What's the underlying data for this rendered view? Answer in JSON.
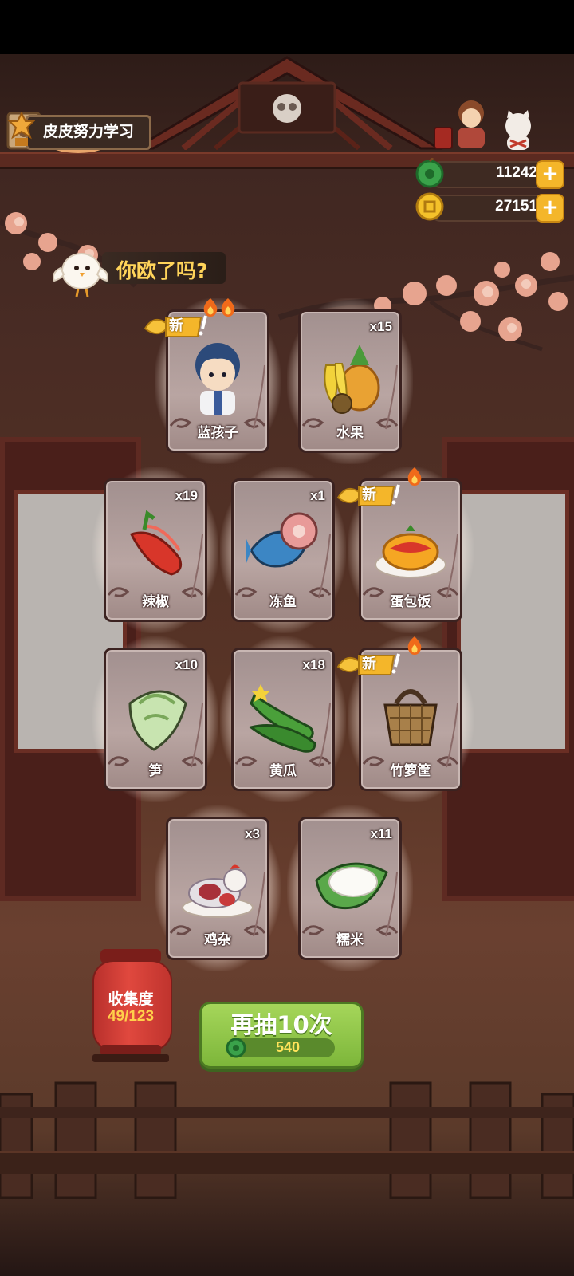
{
  "user": {
    "name": "皮皮努力学习"
  },
  "currencies": [
    {
      "icon": "jade-coin-icon",
      "value": "11242",
      "plus": "+"
    },
    {
      "icon": "gold-coin-icon",
      "value": "27151",
      "plus": "+"
    }
  ],
  "callout": {
    "text": "你欧了吗?"
  },
  "new_label": "新",
  "cards": [
    {
      "name": "蓝孩子",
      "qty": "",
      "is_new": true,
      "art": "boy-character-icon"
    },
    {
      "name": "水果",
      "qty": "x15",
      "is_new": false,
      "art": "fruit-icon"
    },
    {
      "name": "辣椒",
      "qty": "x19",
      "is_new": false,
      "art": "chili-icon"
    },
    {
      "name": "冻鱼",
      "qty": "x1",
      "is_new": false,
      "art": "frozen-fish-icon"
    },
    {
      "name": "蛋包饭",
      "qty": "",
      "is_new": true,
      "art": "omurice-icon"
    },
    {
      "name": "笋",
      "qty": "x10",
      "is_new": false,
      "art": "bamboo-shoot-icon"
    },
    {
      "name": "黄瓜",
      "qty": "x18",
      "is_new": false,
      "art": "cucumber-icon"
    },
    {
      "name": "竹箩筐",
      "qty": "",
      "is_new": true,
      "art": "basket-icon"
    },
    {
      "name": "鸡杂",
      "qty": "x3",
      "is_new": false,
      "art": "chicken-giblets-icon"
    },
    {
      "name": "糯米",
      "qty": "x11",
      "is_new": false,
      "art": "glutinous-rice-icon"
    }
  ],
  "collection": {
    "label": "收集度",
    "progress": "49/123"
  },
  "draw_button": {
    "label": "再抽10次",
    "cost": "540",
    "cost_icon": "jade-coin-icon"
  },
  "colors": {
    "accent_green": "#7db63a",
    "gold": "#f4b62a",
    "label_yellow": "#ffd45a",
    "lantern_red": "#e0483e"
  }
}
